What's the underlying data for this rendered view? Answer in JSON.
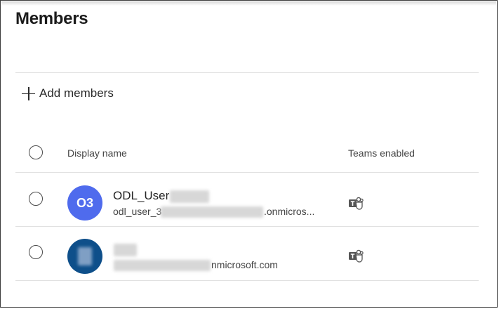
{
  "page": {
    "title": "Members"
  },
  "toolbar": {
    "add_label": "Add members"
  },
  "table": {
    "headers": {
      "display_name": "Display name",
      "teams_enabled": "Teams enabled"
    },
    "rows": [
      {
        "avatar_initials": "O3",
        "avatar_color": "#4f6bed",
        "name": "ODL_User",
        "email_prefix": "odl_user_3",
        "email_suffix": ".onmicros...",
        "teams_icon": "teams-icon"
      },
      {
        "avatar_initials": "",
        "avatar_color": "#0e4f8a",
        "name": "",
        "email_prefix": "",
        "email_suffix": "nmicrosoft.com",
        "teams_icon": "teams-icon"
      }
    ]
  }
}
